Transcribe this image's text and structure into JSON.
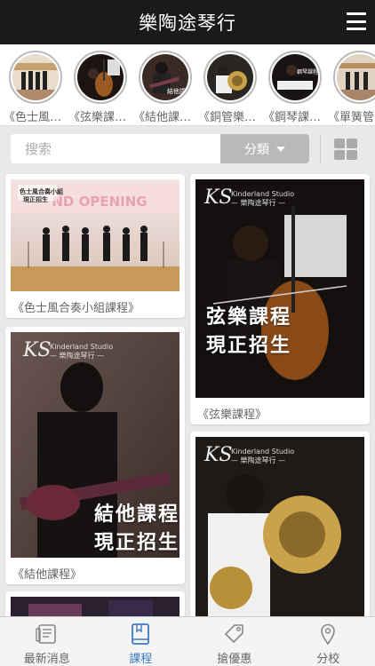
{
  "header": {
    "title": "樂陶途琴行"
  },
  "categories": [
    {
      "label": "《色士風合奏小組課程》",
      "colors": [
        "#d9c2a8",
        "#8c6b5a"
      ]
    },
    {
      "label": "《弦樂課程》",
      "colors": [
        "#2a1e18",
        "#8a5a2a"
      ]
    },
    {
      "label": "《結他課程》",
      "colors": [
        "#1e1a1a",
        "#6a3a2a"
      ]
    },
    {
      "label": "《銅管樂課程》",
      "colors": [
        "#2c2824",
        "#b8963c"
      ]
    },
    {
      "label": "《鋼琴課程》",
      "colors": [
        "#1a1614",
        "#4a2a3a"
      ]
    },
    {
      "label": "《單簧管課程》",
      "colors": [
        "#d4c4b0",
        "#7a5c4c"
      ]
    }
  ],
  "search": {
    "placeholder": "搜索",
    "category_label": "分類"
  },
  "cards": [
    {
      "caption": "《色士風合奏小組課程》",
      "banner": "GRAND OPENING",
      "banner_sub": "色士風合奏小組\n現正招生"
    },
    {
      "caption": "《弦樂課程》",
      "headline1": "弦樂課程",
      "headline2": "現正招生"
    },
    {
      "caption": "《結他課程》",
      "headline1": "結他課程",
      "headline2": "現正招生"
    },
    {
      "caption": ""
    },
    {
      "caption": ""
    }
  ],
  "studio": {
    "name": "Kinderland Studio",
    "sub": "— 樂陶途琴行 —",
    "logo": "KS"
  },
  "tabs": [
    {
      "label": "最新消息",
      "icon": "news-icon",
      "active": false
    },
    {
      "label": "課程",
      "icon": "book-icon",
      "active": true
    },
    {
      "label": "搶優惠",
      "icon": "tag-icon",
      "active": false
    },
    {
      "label": "分校",
      "icon": "location-pin-icon",
      "active": false
    }
  ],
  "colors": {
    "accent": "#3a7bbf",
    "header_bg": "#1a1a1a"
  }
}
